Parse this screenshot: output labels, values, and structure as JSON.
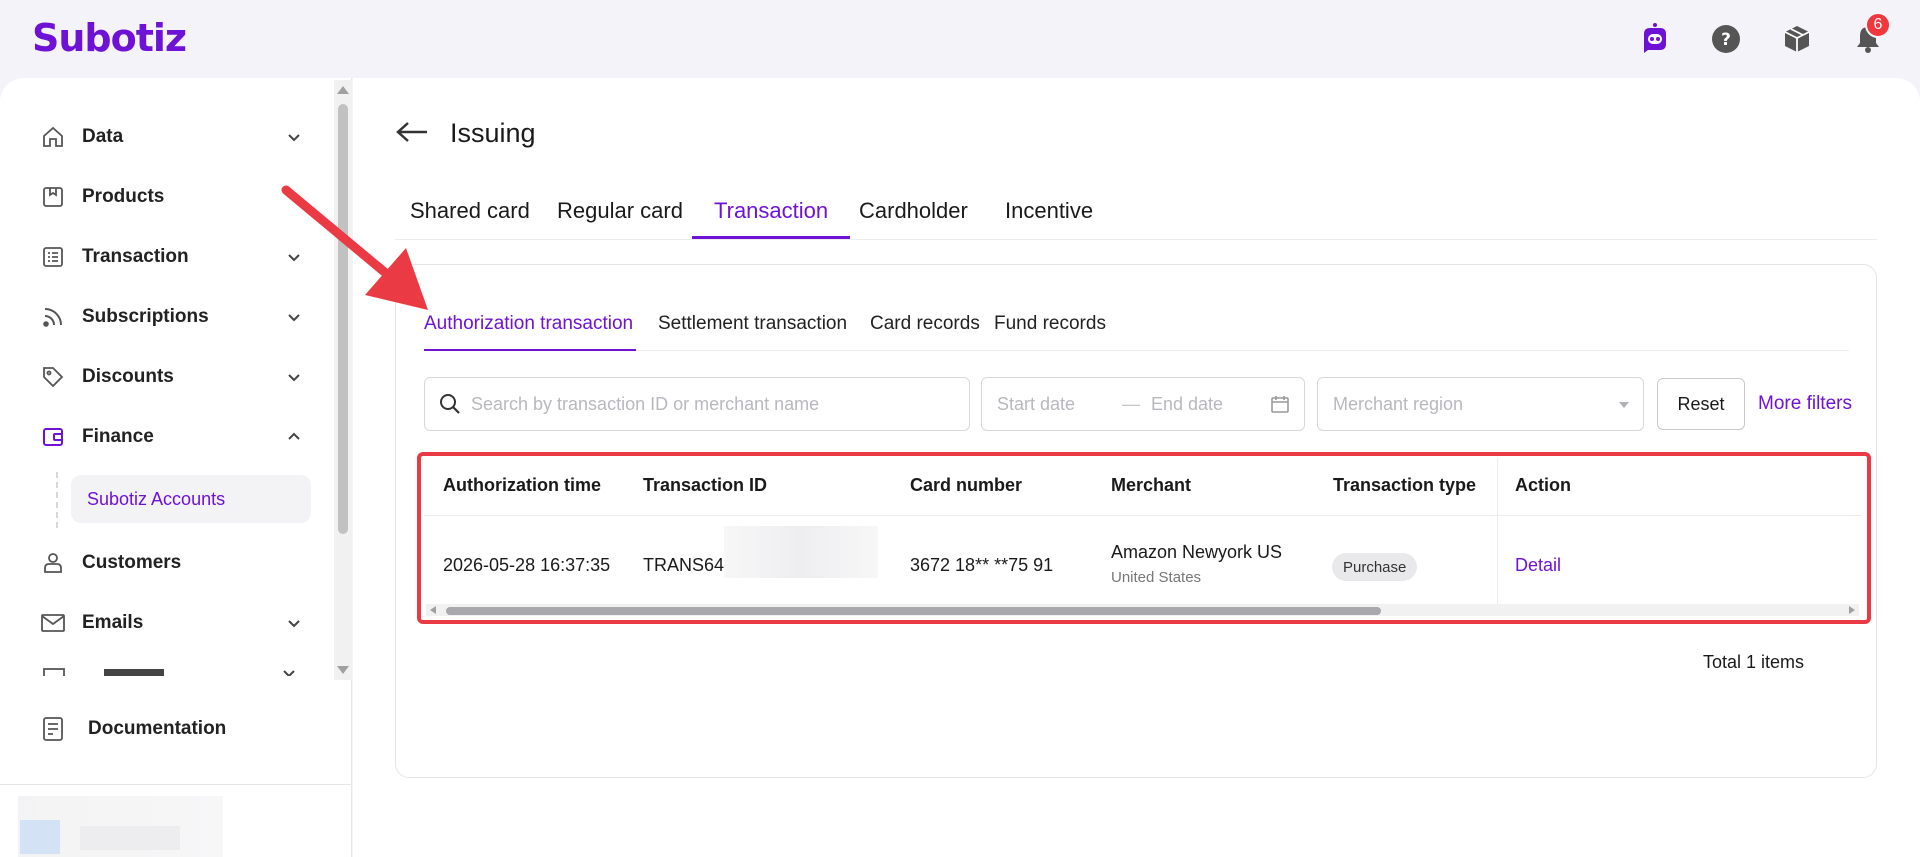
{
  "app": {
    "logo": "Subotiz",
    "notification_count": "6"
  },
  "top_icons": [
    "assistant-bot-icon",
    "help-icon",
    "package-icon",
    "bell-icon"
  ],
  "sidebar": {
    "items": [
      {
        "label": "Data",
        "icon": "home-icon",
        "expanded": false
      },
      {
        "label": "Products",
        "icon": "box-icon",
        "expanded": false
      },
      {
        "label": "Transaction",
        "icon": "list-icon",
        "expanded": false
      },
      {
        "label": "Subscriptions",
        "icon": "rss-icon",
        "expanded": false
      },
      {
        "label": "Discounts",
        "icon": "tag-icon",
        "expanded": false
      },
      {
        "label": "Finance",
        "icon": "wallet-icon",
        "expanded": true
      },
      {
        "label": "Customers",
        "icon": "person-icon",
        "expanded": false
      },
      {
        "label": "Emails",
        "icon": "mail-icon",
        "expanded": false
      },
      {
        "label": "Documentation",
        "icon": "document-icon",
        "expanded": false
      }
    ],
    "finance_sub": "Subotiz Accounts"
  },
  "main": {
    "title": "Issuing",
    "tabs": [
      "Shared card",
      "Regular card",
      "Transaction",
      "Cardholder",
      "Incentive"
    ],
    "active_tab": "Transaction",
    "subtabs": [
      "Authorization transaction",
      "Settlement transaction",
      "Card records",
      "Fund records"
    ],
    "active_subtab": "Authorization transaction",
    "filters": {
      "search_placeholder": "Search by transaction ID or merchant name",
      "start_date": "Start date",
      "date_separator": "—",
      "end_date": "End date",
      "region_placeholder": "Merchant region",
      "reset_label": "Reset",
      "more_filters_label": "More filters"
    },
    "table": {
      "columns": [
        "Authorization time",
        "Transaction ID",
        "Card number",
        "Merchant",
        "Transaction type",
        "Action"
      ],
      "rows": [
        {
          "authorization_time": "2026-05-28 16:37:35",
          "transaction_id": "TRANS64952",
          "card_number": "3672 18** **75 91",
          "merchant": "Amazon Newyork US",
          "merchant_region": "United States",
          "transaction_type": "Purchase",
          "action": "Detail"
        }
      ]
    },
    "total": "Total 1 items"
  },
  "colors": {
    "brand": "#6e12d6",
    "highlight_red": "#ea3b44",
    "badge_red": "#f0373c"
  }
}
